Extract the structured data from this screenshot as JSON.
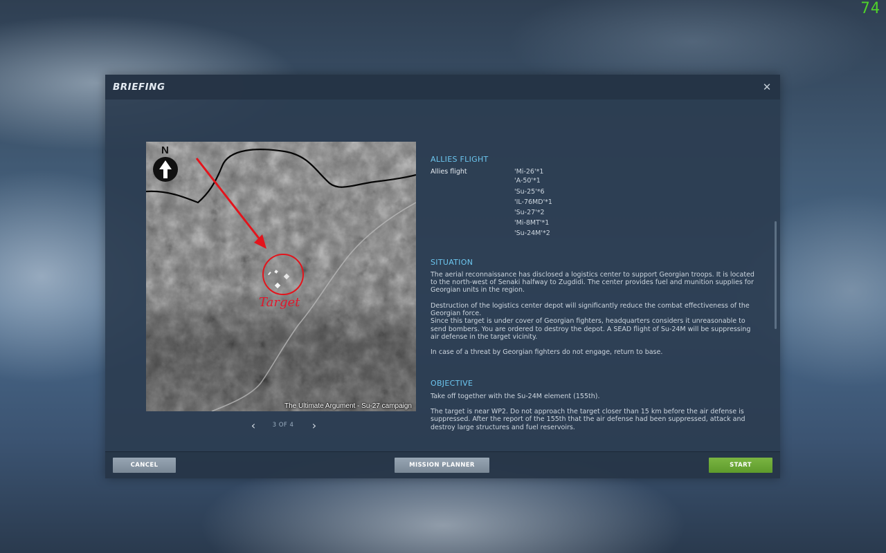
{
  "fps_counter": "74",
  "dialog": {
    "title": "BRIEFING",
    "close_glyph": "✕",
    "close_icon": "close-icon"
  },
  "map": {
    "compass_letter": "N",
    "target_label": "Target",
    "caption": "The Ultimate Argument - Su-27 campaign",
    "pager": {
      "prev_glyph": "‹",
      "next_glyph": "›",
      "page_text": "3 OF 4"
    }
  },
  "briefing": {
    "allies": {
      "title": "ALLIES FLIGHT",
      "label": "Allies flight",
      "units": [
        "'Mi-26'*1",
        "'A-50'*1",
        "'Su-25'*6",
        "'IL-76MD'*1",
        "'Su-27'*2",
        "'Mi-8MT'*1",
        "'Su-24M'*2"
      ]
    },
    "situation": {
      "title": "SITUATION",
      "p1": "The aerial reconnaissance has disclosed a logistics center to support Georgian troops. It is located to the north-west of Senaki halfway to Zugdidi. The center provides fuel and munition supplies for Georgian units in the region.",
      "p2a": "Destruction of the logistics center depot will significantly reduce the combat effectiveness of the Georgian force.",
      "p2b": "Since this target is under cover of Georgian fighters, headquarters considers it unreasonable to send bombers. You are ordered to destroy the depot. A SEAD flight of Su-24M will be suppressing air defense in the target vicinity.",
      "p3": "In case of a threat by Georgian fighters do not engage, return to base."
    },
    "objective": {
      "title": "OBJECTIVE",
      "p1": "Take off together with the Su-24M element (155th).",
      "p2": "The target is near WP2. Do not approach the target closer than 15 km before the air defense is suppressed. After the report of the 155th that the air defense had been suppressed, attack and destroy large structures and fuel reservoirs."
    }
  },
  "footer": {
    "cancel_label": "CANCEL",
    "planner_label": "MISSION PLANNER",
    "start_label": "START"
  },
  "colors": {
    "accent_heading": "#6cc6ef",
    "start_button": "#6aa637",
    "target_marker": "#e0182c",
    "fps_counter": "#4fd32a"
  }
}
